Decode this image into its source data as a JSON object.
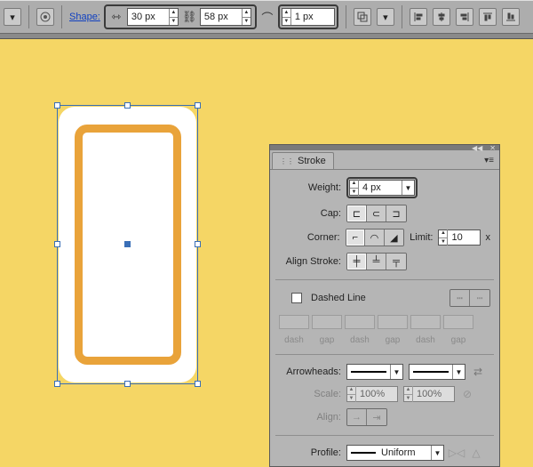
{
  "toolbar": {
    "shape_link": "Shape:",
    "width": "30 px",
    "height": "58 px",
    "corner": "1 px"
  },
  "panel": {
    "tab": "Stroke",
    "weight_label": "Weight:",
    "weight_value": "4 px",
    "cap_label": "Cap:",
    "corner_label": "Corner:",
    "limit_label": "Limit:",
    "limit_value": "10",
    "limit_suffix": "x",
    "align_label": "Align Stroke:",
    "dashed_label": "Dashed Line",
    "dash_cols": [
      "dash",
      "gap",
      "dash",
      "gap",
      "dash",
      "gap"
    ],
    "arrow_label": "Arrowheads:",
    "scale_label": "Scale:",
    "scale_a": "100%",
    "scale_b": "100%",
    "alignarr_label": "Align:",
    "profile_label": "Profile:",
    "profile_value": "Uniform"
  }
}
